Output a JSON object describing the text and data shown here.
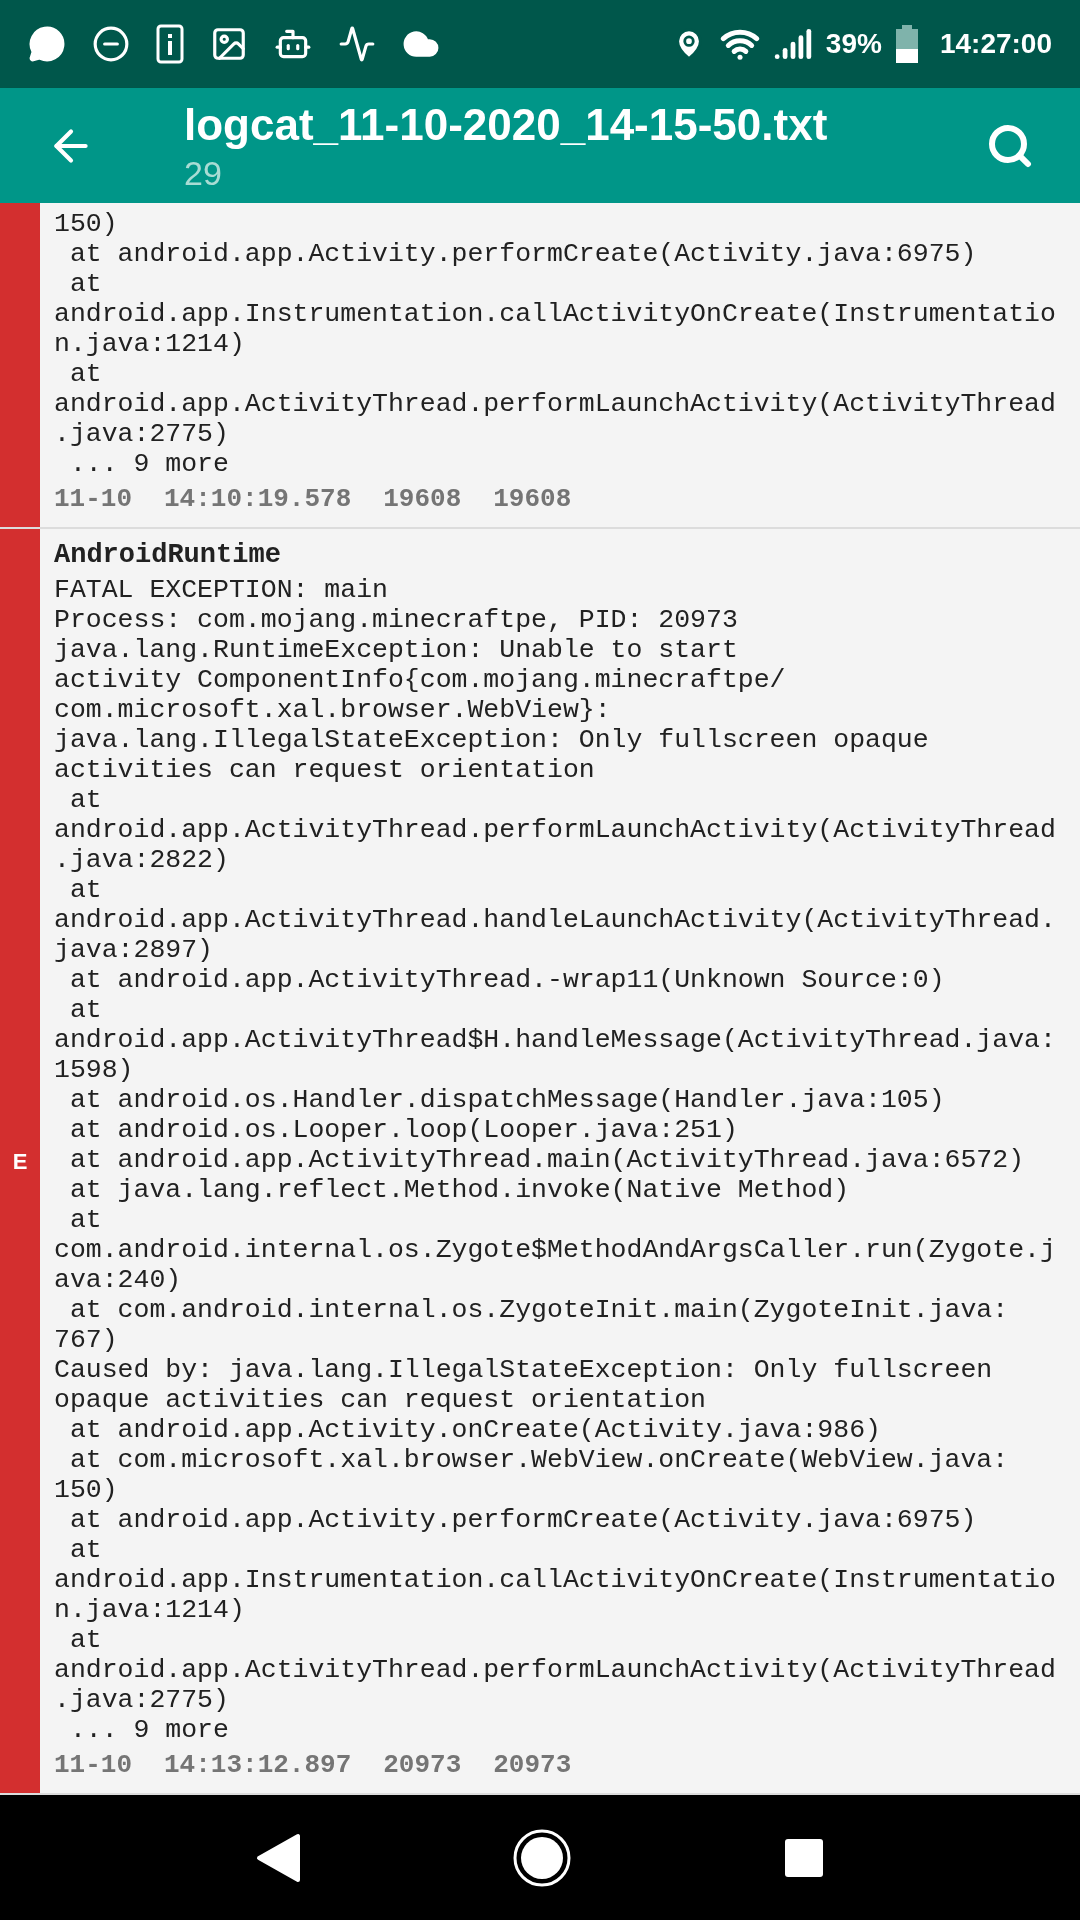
{
  "status_bar": {
    "battery": "39%",
    "time": "14:27:00"
  },
  "app_bar": {
    "title": "logcat_11-10-2020_14-15-50.txt",
    "subtitle": "29"
  },
  "entries": [
    {
      "color": "#d32f2f",
      "lines": [
        "150)",
        " at android.app.Activity.performCreate(Activity.java:6975)",
        " at",
        "android.app.Instrumentation.callActivityOnCreate(Instrumentatio",
        "n.java:1214)",
        " at",
        "android.app.ActivityThread.performLaunchActivity(ActivityThread",
        ".java:2775)",
        " ... 9 more"
      ],
      "date": "11-10",
      "time": "14:10:19.578",
      "pid": "19608",
      "tid": "19608"
    },
    {
      "color": "#d32f2f",
      "level": "E",
      "tag": "AndroidRuntime",
      "lines": [
        "FATAL EXCEPTION: main",
        "Process: com.mojang.minecraftpe, PID: 20973",
        "java.lang.RuntimeException: Unable to start",
        "activity ComponentInfo{com.mojang.minecraftpe/",
        "com.microsoft.xal.browser.WebView}:",
        "java.lang.IllegalStateException: Only fullscreen opaque",
        "activities can request orientation",
        " at",
        "android.app.ActivityThread.performLaunchActivity(ActivityThread",
        ".java:2822)",
        " at",
        "android.app.ActivityThread.handleLaunchActivity(ActivityThread.",
        "java:2897)",
        " at android.app.ActivityThread.-wrap11(Unknown Source:0)",
        " at",
        "android.app.ActivityThread$H.handleMessage(ActivityThread.java:",
        "1598)",
        " at android.os.Handler.dispatchMessage(Handler.java:105)",
        " at android.os.Looper.loop(Looper.java:251)",
        " at android.app.ActivityThread.main(ActivityThread.java:6572)",
        " at java.lang.reflect.Method.invoke(Native Method)",
        " at",
        "com.android.internal.os.Zygote$MethodAndArgsCaller.run(Zygote.j",
        "ava:240)",
        " at com.android.internal.os.ZygoteInit.main(ZygoteInit.java:",
        "767)",
        "Caused by: java.lang.IllegalStateException: Only fullscreen",
        "opaque activities can request orientation",
        " at android.app.Activity.onCreate(Activity.java:986)",
        " at com.microsoft.xal.browser.WebView.onCreate(WebView.java:",
        "150)",
        " at android.app.Activity.performCreate(Activity.java:6975)",
        " at",
        "android.app.Instrumentation.callActivityOnCreate(Instrumentatio",
        "n.java:1214)",
        " at",
        "android.app.ActivityThread.performLaunchActivity(ActivityThread",
        ".java:2775)",
        " ... 9 more"
      ],
      "date": "11-10",
      "time": "14:13:12.897",
      "pid": "20973",
      "tid": "20973"
    }
  ]
}
